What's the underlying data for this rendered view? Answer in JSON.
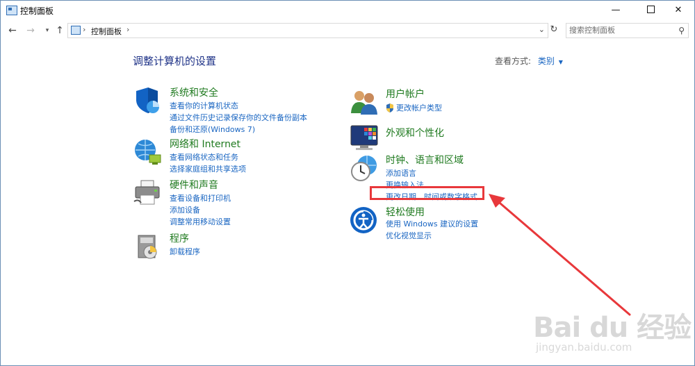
{
  "window": {
    "title": "控制面板"
  },
  "address_bar": {
    "crumb": "控制面板",
    "search_placeholder": "搜索控制面板"
  },
  "main": {
    "title": "调整计算机的设置",
    "view_by_label": "查看方式:",
    "view_by_value": "类别"
  },
  "left_categories": [
    {
      "name": "系统和安全",
      "links": [
        "查看你的计算机状态",
        "通过文件历史记录保存你的文件备份副本",
        "备份和还原(Windows 7)"
      ]
    },
    {
      "name": "网络和 Internet",
      "links": [
        "查看网络状态和任务",
        "选择家庭组和共享选项"
      ]
    },
    {
      "name": "硬件和声音",
      "links": [
        "查看设备和打印机",
        "添加设备",
        "调整常用移动设置"
      ]
    },
    {
      "name": "程序",
      "links": [
        "卸载程序"
      ]
    }
  ],
  "right_categories": [
    {
      "name": "用户帐户",
      "links": [
        "更改帐户类型"
      ]
    },
    {
      "name": "外观和个性化",
      "links": []
    },
    {
      "name": "时钟、语言和区域",
      "links": [
        "添加语言",
        "更换输入法",
        "更改日期、时间或数字格式"
      ]
    },
    {
      "name": "轻松使用",
      "links": [
        "使用 Windows 建议的设置",
        "优化视觉显示"
      ]
    }
  ],
  "watermark": {
    "main": "Bai du 经验",
    "sub": "jingyan.baidu.com"
  },
  "colors": {
    "heading": "#1e3287",
    "category": "#1f7a1f",
    "link": "#1a66c2",
    "annotation": "#e8383b"
  }
}
